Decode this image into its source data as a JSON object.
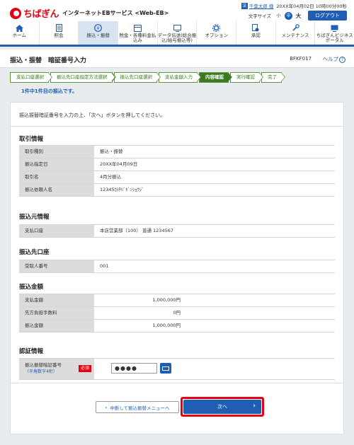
{
  "header": {
    "logo_text": "ちばぎん",
    "service_name": "インターネットEBサービス <Web-EB>",
    "user_icon_text": "法",
    "user_name": "千葉太郎 様",
    "login_time": "20XX年04月02日 10時00分00秒",
    "text_size_label": "文字サイズ",
    "size_small": "小",
    "size_mid": "中",
    "size_large": "大",
    "logout_label": "ログアウト"
  },
  "nav": {
    "items": [
      {
        "label": "ホーム",
        "icon": "home-icon"
      },
      {
        "label": "照会",
        "icon": "inquiry-icon"
      },
      {
        "label": "振込・振替",
        "icon": "transfer-icon"
      },
      {
        "label": "税金・各種料金払込み",
        "icon": "tax-payment-icon"
      },
      {
        "label": "データ伝送(総合振込/給与振込等)",
        "icon": "data-transmission-icon"
      },
      {
        "label": "オプション",
        "icon": "option-icon"
      },
      {
        "label": "承認",
        "icon": "approval-icon"
      },
      {
        "label": "メンテナンス",
        "icon": "maintenance-icon"
      },
      {
        "label": "ちばぎんビジネスポータル",
        "icon": "portal-icon"
      }
    ]
  },
  "title_bar": {
    "title": "振込・振替　暗証番号入力",
    "screen_id": "BFKF017",
    "help_label": "ヘルプ"
  },
  "steps": [
    {
      "label": "支払口座選択",
      "current": false
    },
    {
      "label": "振込先口座指定方法選択",
      "current": false
    },
    {
      "label": "振込先口座選択",
      "current": false
    },
    {
      "label": "支払金額入力",
      "current": false
    },
    {
      "label": "内容確認",
      "current": true
    },
    {
      "label": "実行確認",
      "current": false
    },
    {
      "label": "完了",
      "current": false
    }
  ],
  "progress_text": "1件中1件目の振込です。",
  "instruction": "振込振替暗証番号を入力の上、「次へ」ボタンを押してください。",
  "transaction_info": {
    "title": "取引情報",
    "rows": [
      {
        "label": "取引種別",
        "value": "振込・振替"
      },
      {
        "label": "振込指定日",
        "value": "20XX年04月09日"
      },
      {
        "label": "取引名",
        "value": "4月分振込"
      },
      {
        "label": "振込依頼人名",
        "value": "12345ｶ)ﾁﾊﾞｷﾞﾝｼｮｳｼﾞ"
      }
    ]
  },
  "source_account": {
    "title": "振込元情報",
    "rows": [
      {
        "label": "支払口座",
        "value": "本店営業部（100） 普通 1234567"
      }
    ]
  },
  "destination": {
    "title": "振込先口座",
    "rows": [
      {
        "label": "受取人番号",
        "value": "001"
      }
    ]
  },
  "amounts": {
    "title": "振込金額",
    "rows": [
      {
        "label": "支払金額",
        "value": "1,000,000円"
      },
      {
        "label": "先方負担手数料",
        "value": "0円"
      },
      {
        "label": "振込金額",
        "value": "1,000,000円"
      }
    ]
  },
  "auth": {
    "title": "認証情報",
    "pin_label": "振込振替暗証番号",
    "pin_sub": "（半角数字4桁）",
    "required_badge": "必須",
    "pin_value": "●●●●"
  },
  "buttons": {
    "back_label": "中断して振込振替メニューへ",
    "next_label": "次へ"
  },
  "colors": {
    "brand_red": "#e60012",
    "brand_blue": "#1f5fb3",
    "step_green": "#3b7a22"
  }
}
